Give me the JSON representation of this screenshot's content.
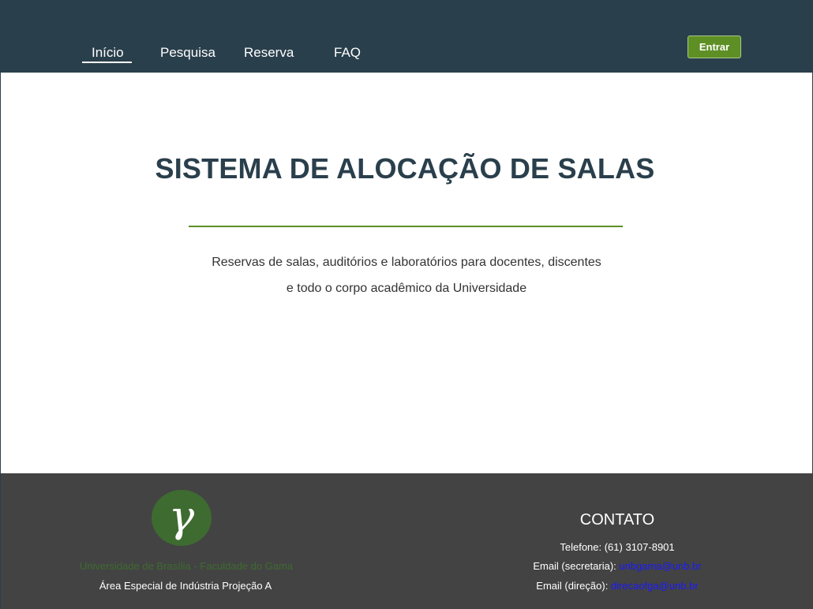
{
  "nav": {
    "items": [
      {
        "label": "Início",
        "active": true
      },
      {
        "label": "Pesquisa",
        "active": false
      },
      {
        "label": "Reserva",
        "active": false
      },
      {
        "label": "FAQ",
        "active": false
      }
    ],
    "login_label": "Entrar"
  },
  "hero": {
    "title": "SISTEMA DE ALOCAÇÃO DE SALAS",
    "line1": "Reservas de salas, auditórios e laboratórios para docentes, discentes",
    "line2": "e todo o corpo acadêmico da Universidade"
  },
  "footer": {
    "logo_glyph": "γ",
    "institution": "Universidade de Brasília - Faculdade do Gama",
    "address": "Área Especial de Indústria Projeção A",
    "contact_title": "CONTATO",
    "phone": "Telefone: (61) 3107-8901",
    "email_secretaria_label": "Email (secretaria):",
    "email_secretaria": "unbgama@unb.br",
    "email_direcao_label": "Email (direção):",
    "email_direcao": "direcaofga@unb.br"
  },
  "colors": {
    "navbar_bg": "#2a3f4c",
    "accent_green": "#5e8f25",
    "footer_bg": "#434343",
    "link_blue": "#1a1aff"
  }
}
